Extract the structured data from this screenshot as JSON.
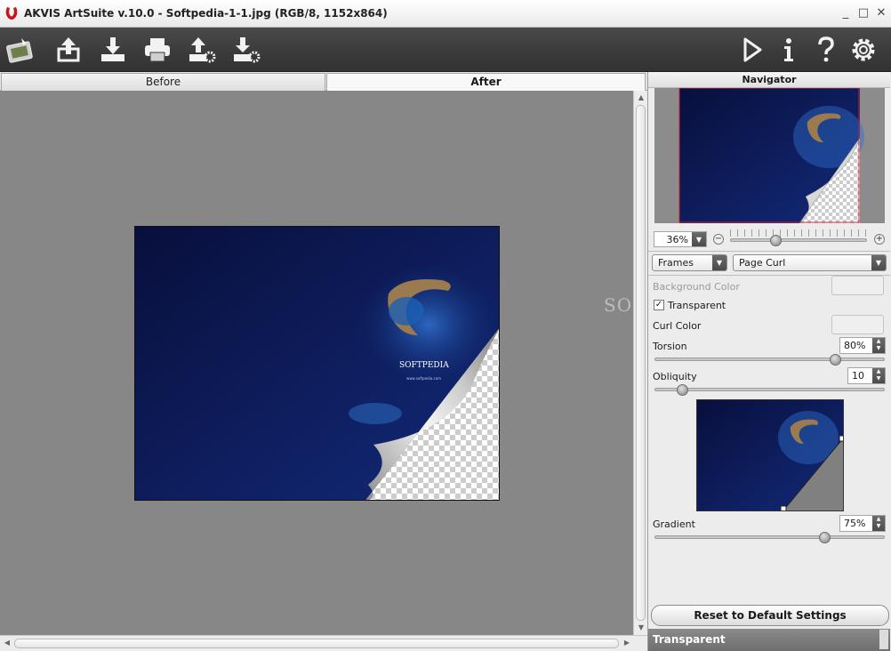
{
  "window": {
    "title": "AKVIS ArtSuite v.10.0 - Softpedia-1-1.jpg (RGB/8, 1152x864)",
    "controls": [
      "_",
      "□",
      "✕"
    ]
  },
  "toolbar": {
    "left_icons": [
      "artsuite-logo-icon",
      "open-image-icon",
      "save-image-icon",
      "print-icon",
      "load-preset-icon",
      "save-preset-icon"
    ],
    "right_icons": [
      "run-icon",
      "info-icon",
      "help-icon",
      "settings-icon"
    ]
  },
  "tabs": {
    "before": "Before",
    "after": "After",
    "active": "After"
  },
  "image": {
    "caption": "SOFTPEDIA",
    "url": "www.softpedia.com"
  },
  "watermark": "SOFT",
  "navigator": {
    "title": "Navigator",
    "zoom": "36%"
  },
  "settings": {
    "category": "Frames",
    "effect": "Page Curl",
    "background_color_label": "Background Color",
    "transparent_label": "Transparent",
    "transparent_checked": true,
    "curl_color_label": "Curl Color",
    "torsion_label": "Torsion",
    "torsion_value": "80%",
    "torsion_level": 0.8,
    "obliquity_label": "Obliquity",
    "obliquity_value": "10",
    "obliquity_level": 0.1,
    "gradient_label": "Gradient",
    "gradient_value": "75%",
    "gradient_level": 0.75,
    "reset_label": "Reset to Default Settings"
  },
  "status": {
    "hint": "Transparent"
  },
  "colors": {
    "toolbar_bg": "#3e3e3e",
    "canvas_bg": "#878787",
    "image_bg": "#0c1550",
    "status_bg": "#7a7a7a"
  }
}
